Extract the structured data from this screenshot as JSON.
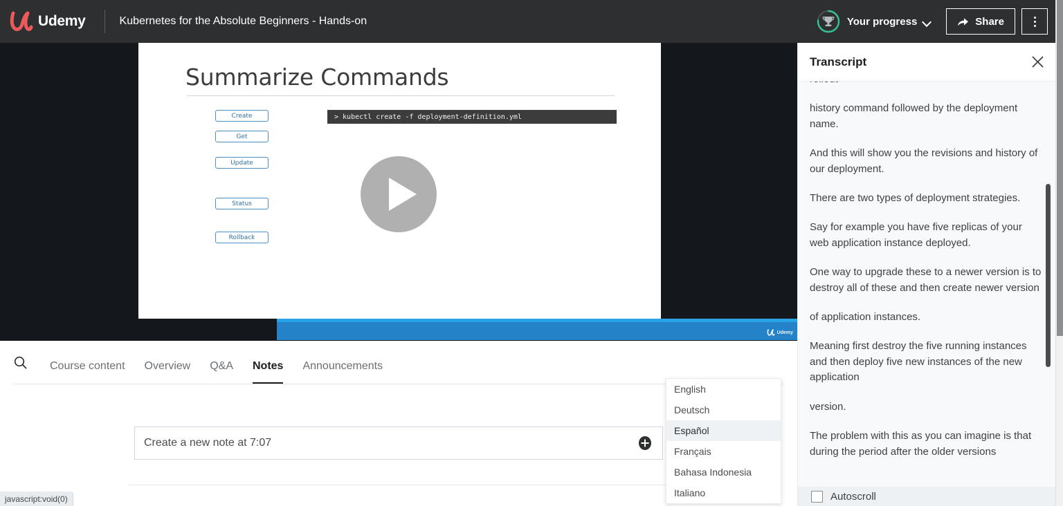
{
  "header": {
    "brand_name": "Udemy",
    "brand_mark_icon": "udemy-logo-icon",
    "course_title": "Kubernetes for the Absolute Beginners - Hands-on",
    "progress_label": "Your progress",
    "progress_icon": "trophy-icon",
    "progress_ring_color": "#35c490",
    "chevron_icon": "chevron-down-icon",
    "share_label": "Share",
    "share_icon": "share-arrow-icon",
    "more_icon": "kebab-menu-icon",
    "background_color": "#2d2f31"
  },
  "video": {
    "play_icon": "play-button-icon",
    "letterbox_color": "#14181d",
    "control_bar_color": "#2382c8",
    "control_bar_accent": "#29a3e8",
    "watermark_text": "Udemy",
    "slide": {
      "title": "Summarize Commands",
      "buttons": [
        "Create",
        "Get",
        "Update",
        "Status",
        "Rollback"
      ],
      "terminal_command": "> kubectl create -f deployment-definition.yml",
      "button_border_color": "#4a90c4",
      "terminal_background": "#3c3c3c"
    }
  },
  "tabs": {
    "search_icon": "search-icon",
    "items": [
      {
        "label": "Course content",
        "active": false
      },
      {
        "label": "Overview",
        "active": false
      },
      {
        "label": "Q&A",
        "active": false
      },
      {
        "label": "Notes",
        "active": true
      },
      {
        "label": "Announcements",
        "active": false
      }
    ]
  },
  "notes": {
    "input_placeholder": "Create a new note at 7:07",
    "add_icon": "plus-circle-icon"
  },
  "language_menu": {
    "items": [
      {
        "label": "English",
        "selected": false
      },
      {
        "label": "Deutsch",
        "selected": false
      },
      {
        "label": "Español",
        "selected": true
      },
      {
        "label": "Français",
        "selected": false
      },
      {
        "label": "Bahasa Indonesia",
        "selected": false
      },
      {
        "label": "Italiano",
        "selected": false
      }
    ]
  },
  "transcript": {
    "title": "Transcript",
    "close_icon": "close-icon",
    "autoscroll_label": "Autoscroll",
    "autoscroll_checked": false,
    "lines": [
      "rollout",
      "history command followed by the deployment name.",
      "And this will show you the revisions and history of our deployment.",
      "There are two types of deployment strategies.",
      "Say for example you have five replicas of your web application instance deployed.",
      "One way to upgrade these to a newer version is to destroy all of these and then create newer version",
      "of application instances.",
      "Meaning first destroy the five running instances and then deploy five new instances of the new application",
      "version.",
      "The problem with this as you can imagine is that during the period after the older versions"
    ]
  },
  "status_bar": {
    "text": "javascript:void(0)"
  }
}
